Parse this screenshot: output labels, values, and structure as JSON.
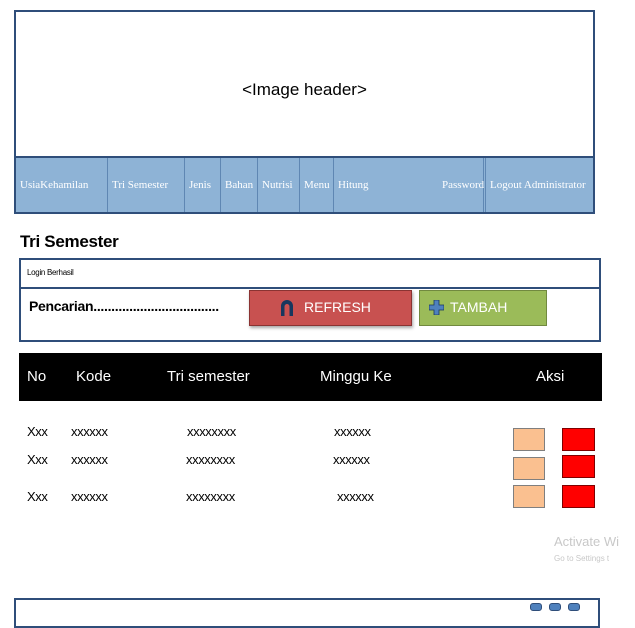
{
  "header": {
    "image_placeholder": "<Image header>"
  },
  "nav": {
    "items": [
      {
        "label": "UsiaKehamilan"
      },
      {
        "label": "Tri Semester"
      },
      {
        "label": "Jenis"
      },
      {
        "label": "Bahan"
      },
      {
        "label": "Nutrisi"
      },
      {
        "label": "Menu"
      },
      {
        "label": "Hitung"
      },
      {
        "label": "Password"
      },
      {
        "label": "Logout Administrator"
      }
    ]
  },
  "page": {
    "title": "Tri Semester"
  },
  "search_panel": {
    "status": "Login Berhasil",
    "search_label": "Pencarian...................................",
    "refresh_label": "REFRESH",
    "tambah_label": "TAMBAH"
  },
  "table": {
    "headers": [
      "No",
      "Kode",
      "Tri semester",
      "Minggu Ke",
      "Aksi"
    ],
    "rows": [
      [
        "Xxx",
        "xxxxxx",
        "xxxxxxxx",
        "xxxxxx"
      ],
      [
        "Xxx",
        "xxxxxx",
        "xxxxxxxx",
        "xxxxxx"
      ],
      [
        "Xxx",
        "xxxxxx",
        "xxxxxxxx",
        "xxxxxx"
      ]
    ]
  },
  "watermark": {
    "title": "Activate Wi",
    "subtitle": "Go to Settings t"
  },
  "colors": {
    "frame_border": "#2f4e7a",
    "nav_background": "#8eb3d6",
    "refresh_button": "#c85150",
    "tambah_button": "#9bbb59",
    "edit_action": "#fac090",
    "delete_action": "#ff0000",
    "table_header": "#000000"
  },
  "icons": {
    "refresh": "arch-icon",
    "tambah": "plus-icon"
  }
}
